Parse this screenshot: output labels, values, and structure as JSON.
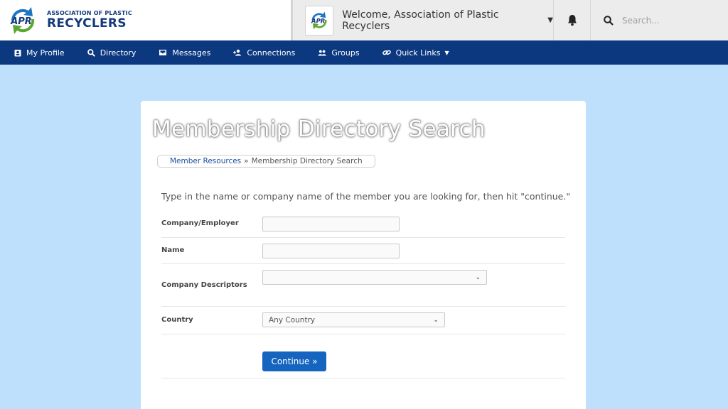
{
  "header": {
    "brand_line1": "ASSOCIATION OF PLASTIC",
    "brand_line2": "RECYCLERS",
    "brand_mark": "APR",
    "welcome": "Welcome, Association of Plastic Recyclers",
    "search_placeholder": "Search..."
  },
  "nav": [
    {
      "label": "My Profile",
      "icon": "profile-icon"
    },
    {
      "label": "Directory",
      "icon": "search-icon"
    },
    {
      "label": "Messages",
      "icon": "inbox-icon"
    },
    {
      "label": "Connections",
      "icon": "add-user-icon"
    },
    {
      "label": "Groups",
      "icon": "group-icon"
    },
    {
      "label": "Quick Links",
      "icon": "link-icon"
    }
  ],
  "page": {
    "title": "Membership Directory Search",
    "breadcrumb": {
      "link": "Member Resources",
      "separator": "»",
      "current": "Membership Directory Search"
    },
    "intro": "Type in the name or company name of the member you are looking for, then hit \"continue.\""
  },
  "form": {
    "company_label": "Company/Employer",
    "company_value": "",
    "name_label": "Name",
    "name_value": "",
    "descriptors_label": "Company Descriptors",
    "descriptors_value": "",
    "country_label": "Country",
    "country_value": "Any Country",
    "continue_label": "Continue »"
  },
  "colors": {
    "nav_bg": "#0c3880",
    "page_bg": "#bfe0fd",
    "button": "#1565c0",
    "brand": "#143a7b",
    "logo_green": "#5aa832",
    "logo_blue": "#1f74c4"
  }
}
